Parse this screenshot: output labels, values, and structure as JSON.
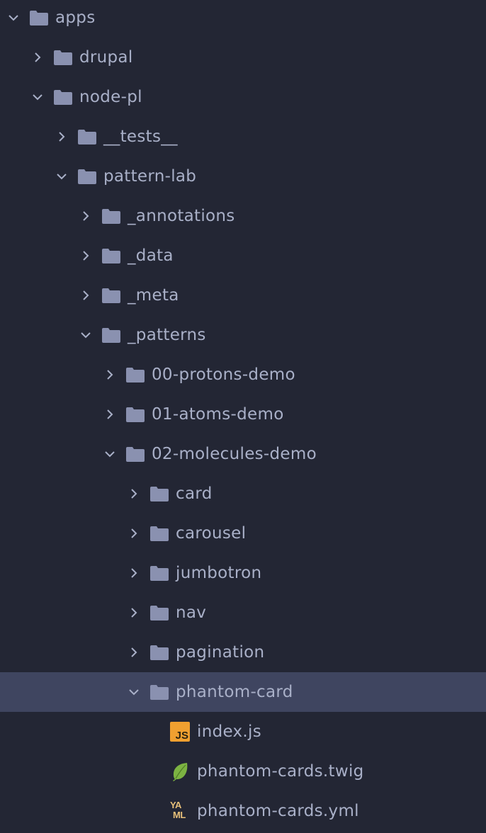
{
  "tree": {
    "rows": [
      {
        "label": "apps",
        "type": "folder",
        "expanded": true,
        "depth": 0
      },
      {
        "label": "drupal",
        "type": "folder",
        "expanded": false,
        "depth": 1
      },
      {
        "label": "node-pl",
        "type": "folder",
        "expanded": true,
        "depth": 1
      },
      {
        "label": "__tests__",
        "type": "folder",
        "expanded": false,
        "depth": 2
      },
      {
        "label": "pattern-lab",
        "type": "folder",
        "expanded": true,
        "depth": 2
      },
      {
        "label": "_annotations",
        "type": "folder",
        "expanded": false,
        "depth": 3
      },
      {
        "label": "_data",
        "type": "folder",
        "expanded": false,
        "depth": 3
      },
      {
        "label": "_meta",
        "type": "folder",
        "expanded": false,
        "depth": 3
      },
      {
        "label": "_patterns",
        "type": "folder",
        "expanded": true,
        "depth": 3
      },
      {
        "label": "00-protons-demo",
        "type": "folder",
        "expanded": false,
        "depth": 4
      },
      {
        "label": "01-atoms-demo",
        "type": "folder",
        "expanded": false,
        "depth": 4
      },
      {
        "label": "02-molecules-demo",
        "type": "folder",
        "expanded": true,
        "depth": 4
      },
      {
        "label": "card",
        "type": "folder",
        "expanded": false,
        "depth": 5
      },
      {
        "label": "carousel",
        "type": "folder",
        "expanded": false,
        "depth": 5
      },
      {
        "label": "jumbotron",
        "type": "folder",
        "expanded": false,
        "depth": 5
      },
      {
        "label": "nav",
        "type": "folder",
        "expanded": false,
        "depth": 5
      },
      {
        "label": "pagination",
        "type": "folder",
        "expanded": false,
        "depth": 5
      },
      {
        "label": "phantom-card",
        "type": "folder",
        "expanded": true,
        "depth": 5,
        "selected": true
      },
      {
        "label": "index.js",
        "type": "file",
        "icon": "js-file-icon",
        "depth": 6
      },
      {
        "label": "phantom-cards.twig",
        "type": "file",
        "icon": "twig-leaf-icon",
        "depth": 6
      },
      {
        "label": "phantom-cards.yml",
        "type": "file",
        "icon": "yaml-file-icon",
        "depth": 6
      }
    ],
    "icons": {
      "js_badge_text": "JS",
      "yml_line1": "YA",
      "yml_line2": "ML"
    },
    "colors": {
      "background": "#232634",
      "selected_row": "#3f4560",
      "text": "#a9b0c8",
      "folder": "#8a91b0",
      "js_badge": "#f0a030",
      "twig_leaf": "#7cb342",
      "yaml": "#e8c07a"
    }
  }
}
